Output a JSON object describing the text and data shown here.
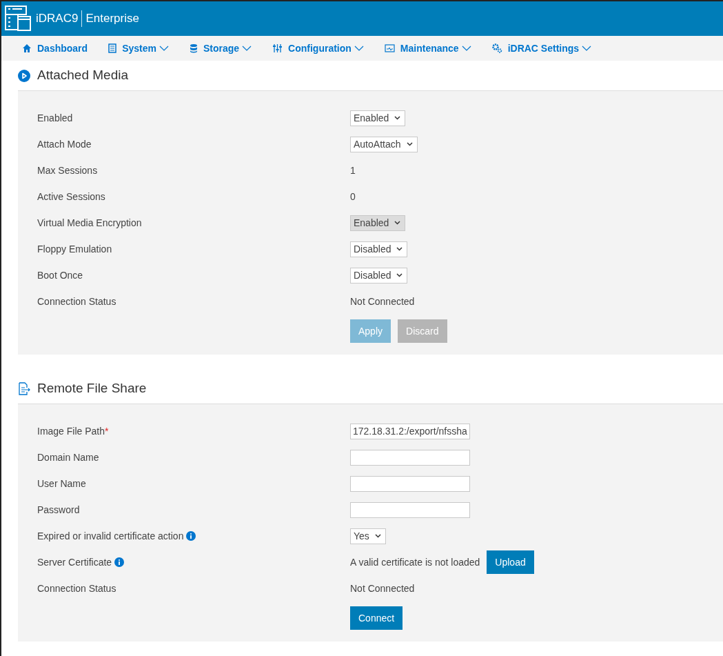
{
  "header": {
    "product": "iDRAC9",
    "edition": "Enterprise"
  },
  "nav": [
    {
      "label": "Dashboard",
      "dropdown": false
    },
    {
      "label": "System",
      "dropdown": true
    },
    {
      "label": "Storage",
      "dropdown": true
    },
    {
      "label": "Configuration",
      "dropdown": true
    },
    {
      "label": "Maintenance",
      "dropdown": true
    },
    {
      "label": "iDRAC Settings",
      "dropdown": true
    }
  ],
  "sections": [
    {
      "title": "Attached Media",
      "rows": [
        {
          "kind": "select",
          "label": "Enabled",
          "value": "Enabled",
          "disabled": false
        },
        {
          "kind": "select",
          "label": "Attach Mode",
          "value": "AutoAttach",
          "disabled": false
        },
        {
          "kind": "text",
          "label": "Max Sessions",
          "value": "1"
        },
        {
          "kind": "text",
          "label": "Active Sessions",
          "value": "0"
        },
        {
          "kind": "select",
          "label": "Virtual Media Encryption",
          "value": "Enabled",
          "disabled": true
        },
        {
          "kind": "select",
          "label": "Floppy Emulation",
          "value": "Disabled",
          "disabled": false
        },
        {
          "kind": "select",
          "label": "Boot Once",
          "value": "Disabled",
          "disabled": false
        },
        {
          "kind": "text",
          "label": "Connection Status",
          "value": "Not Connected"
        },
        {
          "kind": "buttons",
          "buttons": [
            {
              "label": "Apply",
              "disabled": true
            },
            {
              "label": "Discard",
              "disabled": true
            }
          ]
        }
      ]
    },
    {
      "title": "Remote File Share",
      "rows": [
        {
          "kind": "input",
          "label": "Image File Path",
          "required_mark": "*",
          "info": false,
          "value": "172.18.31.2:/export/nfssha"
        },
        {
          "kind": "input",
          "label": "Domain Name",
          "info": false
        },
        {
          "kind": "input",
          "label": "User Name",
          "info": false
        },
        {
          "kind": "input",
          "label": "Password",
          "info": false
        },
        {
          "kind": "select",
          "label": "Expired or invalid certificate action",
          "info": true,
          "value": "Yes",
          "disabled": false
        },
        {
          "kind": "text_button",
          "label": "Server Certificate",
          "info": true,
          "value": "A valid certificate is not loaded",
          "button": {
            "label": "Upload",
            "disabled": false
          }
        },
        {
          "kind": "text",
          "label": "Connection Status",
          "info": false,
          "value": "Not Connected"
        },
        {
          "kind": "buttons",
          "buttons": [
            {
              "label": "Connect",
              "disabled": false
            }
          ]
        }
      ]
    }
  ]
}
